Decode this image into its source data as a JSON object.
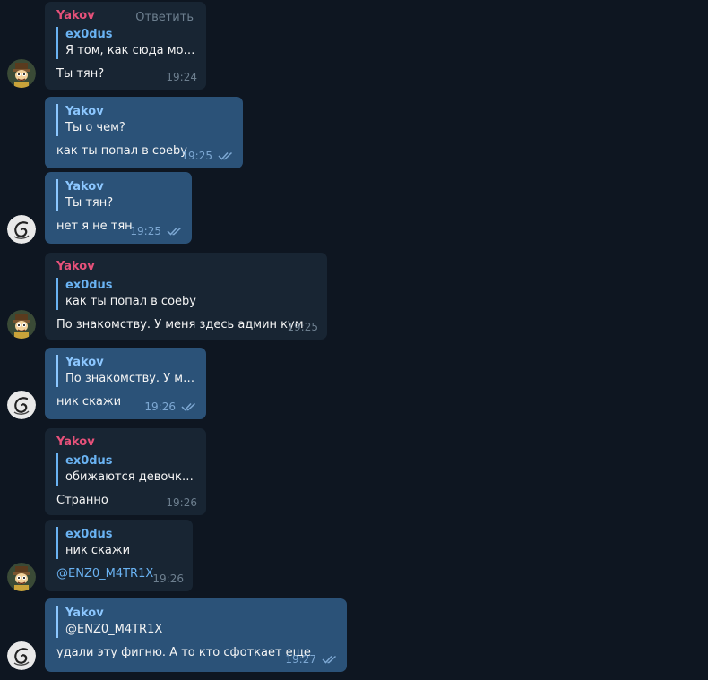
{
  "reply_label": "Ответить",
  "messages": [
    {
      "sender": "Yakov",
      "quote_author": "ex0dus",
      "quote_text": "Я том, как сюда мог п...",
      "text": "Ты тян?",
      "time": "19:24",
      "avatar": "cartoon-avatar-icon"
    },
    {
      "quote_author": "Yakov",
      "quote_text": "Ты о чем?",
      "text": "как ты попал в coeby",
      "time": "19:25",
      "status": "read"
    },
    {
      "quote_author": "Yakov",
      "quote_text": "Ты тян?",
      "text": "нет я не тян",
      "time": "19:25",
      "status": "read",
      "avatar": "swirl-avatar-icon"
    },
    {
      "sender": "Yakov",
      "quote_author": "ex0dus",
      "quote_text": "как ты попал в coeby",
      "text": "По знакомству. У меня здесь админ кум",
      "time": "19:25",
      "avatar": "cartoon-avatar-icon"
    },
    {
      "quote_author": "Yakov",
      "quote_text": "По знакомству. У мен...",
      "text": "ник скажи",
      "time": "19:26",
      "status": "read",
      "avatar": "swirl-avatar-icon"
    },
    {
      "sender": "Yakov",
      "quote_author": "ex0dus",
      "quote_text": "обижаются девочки, ...",
      "text": "Странно",
      "time": "19:26"
    },
    {
      "quote_author": "ex0dus",
      "quote_text": "ник скажи",
      "text": "@ENZ0_M4TR1X",
      "time": "19:26",
      "avatar": "cartoon-avatar-icon"
    },
    {
      "quote_author": "Yakov",
      "quote_text": "@ENZ0_M4TR1X",
      "text": "удали эту фигню. А то кто сфоткает еще",
      "time": "19:27",
      "status": "read",
      "avatar": "swirl-avatar-icon"
    }
  ],
  "colors": {
    "background": "#0e1621",
    "incoming": "#182533",
    "outgoing": "#2b5278",
    "sender": "#e6517a",
    "link": "#6ab3f3"
  }
}
